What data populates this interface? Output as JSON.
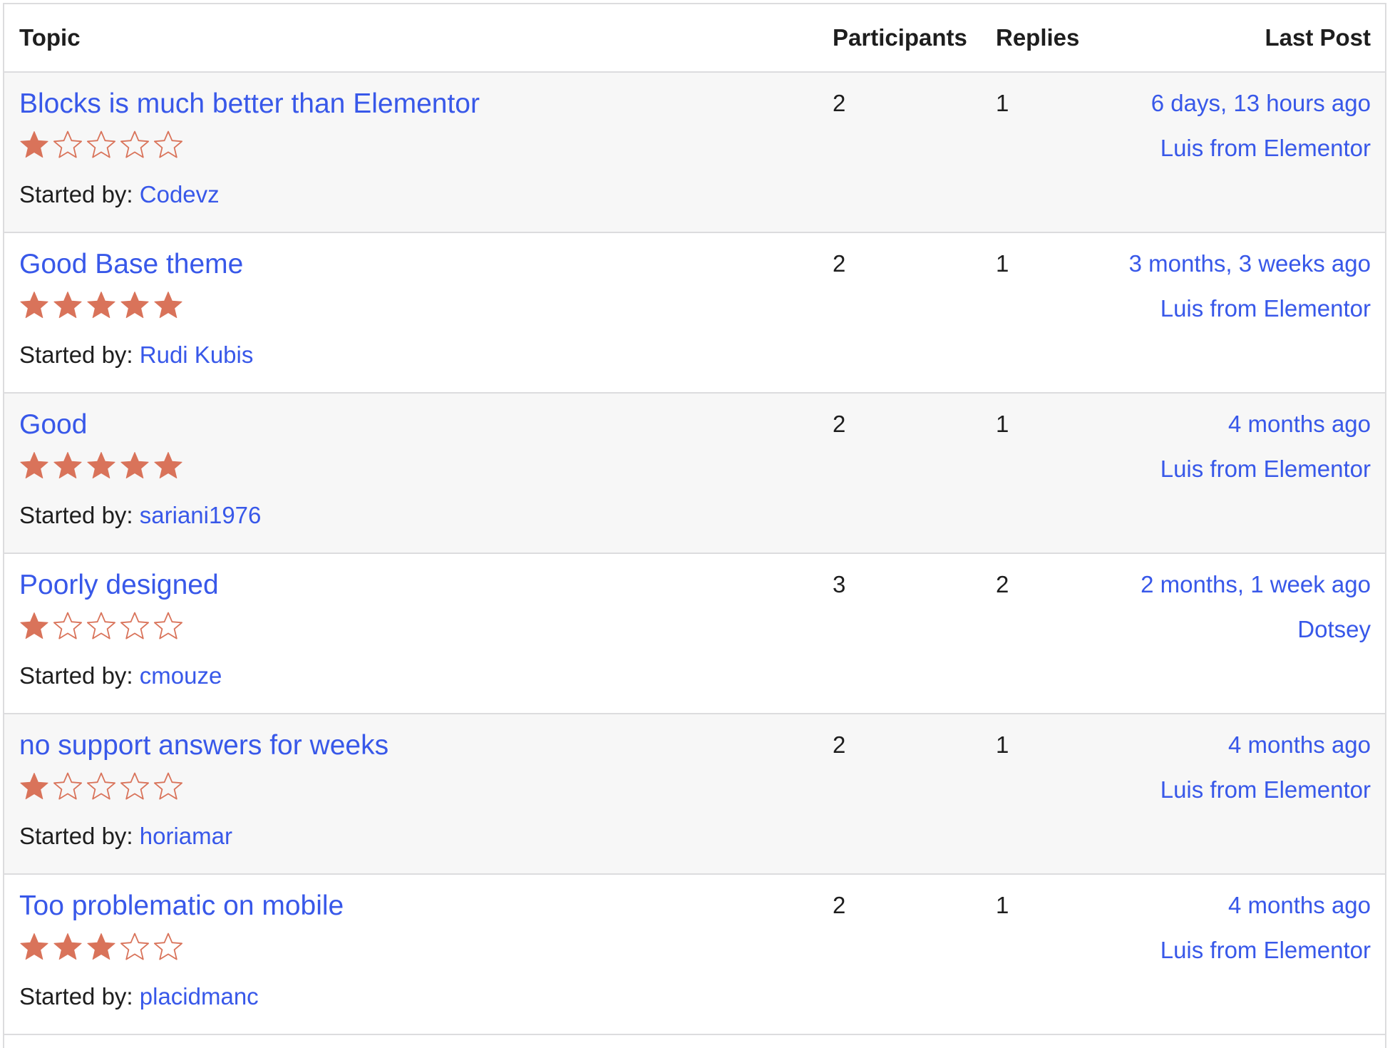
{
  "header": {
    "topic": "Topic",
    "participants": "Participants",
    "replies": "Replies",
    "last_post": "Last Post"
  },
  "started_by_label": "Started by:",
  "star_color": "#d9735a",
  "rows": [
    {
      "title": "Blocks is much better than Elementor",
      "rating": 1,
      "author": "Codevz",
      "participants": "2",
      "replies": "1",
      "last_time": "6 days, 13 hours ago",
      "last_author": "Luis from Elementor"
    },
    {
      "title": "Good Base theme",
      "rating": 5,
      "author": "Rudi Kubis",
      "participants": "2",
      "replies": "1",
      "last_time": "3 months, 3 weeks ago",
      "last_author": "Luis from Elementor"
    },
    {
      "title": "Good",
      "rating": 5,
      "author": "sariani1976",
      "participants": "2",
      "replies": "1",
      "last_time": "4 months ago",
      "last_author": "Luis from Elementor"
    },
    {
      "title": "Poorly designed",
      "rating": 1,
      "author": "cmouze",
      "participants": "3",
      "replies": "2",
      "last_time": "2 months, 1 week ago",
      "last_author": "Dotsey"
    },
    {
      "title": "no support answers for weeks",
      "rating": 1,
      "author": "horiamar",
      "participants": "2",
      "replies": "1",
      "last_time": "4 months ago",
      "last_author": "Luis from Elementor"
    },
    {
      "title": "Too problematic on mobile",
      "rating": 3,
      "author": "placidmanc",
      "participants": "2",
      "replies": "1",
      "last_time": "4 months ago",
      "last_author": "Luis from Elementor"
    }
  ]
}
